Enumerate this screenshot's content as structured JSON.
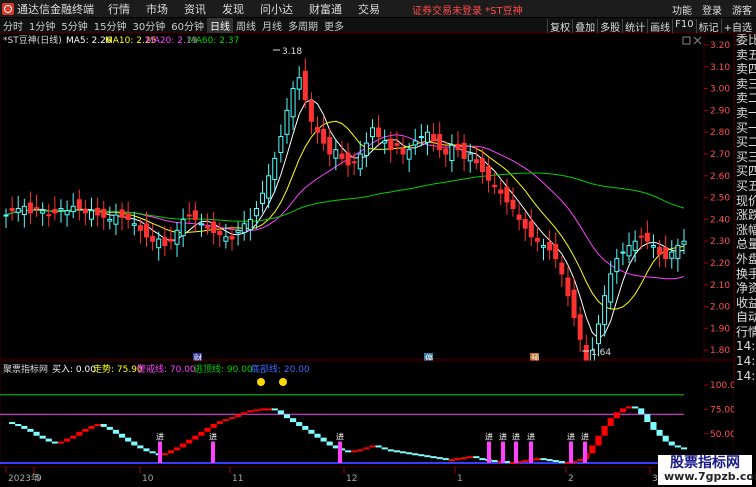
{
  "titlebar": {
    "app_name": "通达信金融终端",
    "menus": [
      "行情",
      "市场",
      "资讯",
      "发现",
      "问小达",
      "财富通",
      "交易"
    ],
    "notice": "证券交易未登录 *ST豆神",
    "right_items": [
      "功能",
      "登录",
      "游客"
    ]
  },
  "toolbar": {
    "periods": [
      "分时",
      "1分钟",
      "5分钟",
      "15分钟",
      "30分钟",
      "60分钟",
      "日线",
      "周线",
      "月线",
      "多周期",
      "更多"
    ],
    "active_period": "日线",
    "tools": [
      "复权",
      "叠加",
      "多股",
      "统计",
      "画线",
      "F10",
      "标记",
      "+自选"
    ]
  },
  "main_chart": {
    "legend": {
      "stock": "*ST豆神(日线)",
      "ma5": "MA5: 2.26",
      "ma10": "MA10: 2.25",
      "ma20": "MA20: 2.19",
      "ma60": "MA60: 2.37"
    },
    "high_label": "3.18",
    "low_label": "1.64",
    "price_axis": [
      "3.20",
      "3.10",
      "3.00",
      "2.90",
      "2.80",
      "2.70",
      "2.60",
      "2.50",
      "2.40",
      "2.30",
      "2.20",
      "2.10",
      "2.00",
      "1.90",
      "1.80"
    ],
    "markers": [
      "财",
      "停",
      "预"
    ]
  },
  "indicator": {
    "legend": {
      "name": "聚票指标网",
      "buy": "买入: 0.00",
      "trend": "走势: 75.90",
      "warn": "警戒线: 70.00",
      "escape": "逃顶线: 90.00",
      "bottom": "底部线: 20.00"
    },
    "axis": [
      "100.0",
      "75.00",
      "50.00"
    ],
    "tag": "进"
  },
  "side_panel": {
    "items": [
      "委比",
      "卖五",
      "卖四",
      "卖三",
      "卖二",
      "卖一",
      "买一",
      "买二",
      "买三",
      "买四",
      "买五",
      "现价",
      "涨跌",
      "涨幅",
      "总量",
      "外盘",
      "换手",
      "净资",
      "收益",
      "自动",
      "行情",
      "14:5",
      "14:5",
      "14:5",
      "14:5",
      "14:5",
      "14:5",
      "14:5",
      "14:5",
      "14:5"
    ]
  },
  "date_axis": [
    "2023年",
    "9",
    "10",
    "11",
    "12",
    "1",
    "2",
    "3"
  ],
  "watermark": {
    "line1": "股票指标网",
    "line2": "www.7gpzb.com"
  },
  "colors": {
    "up": "#54ffff",
    "down": "#ff3232",
    "ma5": "#ffffff",
    "ma10": "#ffff00",
    "ma20": "#ff40ff",
    "ma60": "#00d000",
    "indicator_up": "#ff0000",
    "indicator_down": "#7fffff",
    "signal_bar": "#ff40ff"
  }
}
